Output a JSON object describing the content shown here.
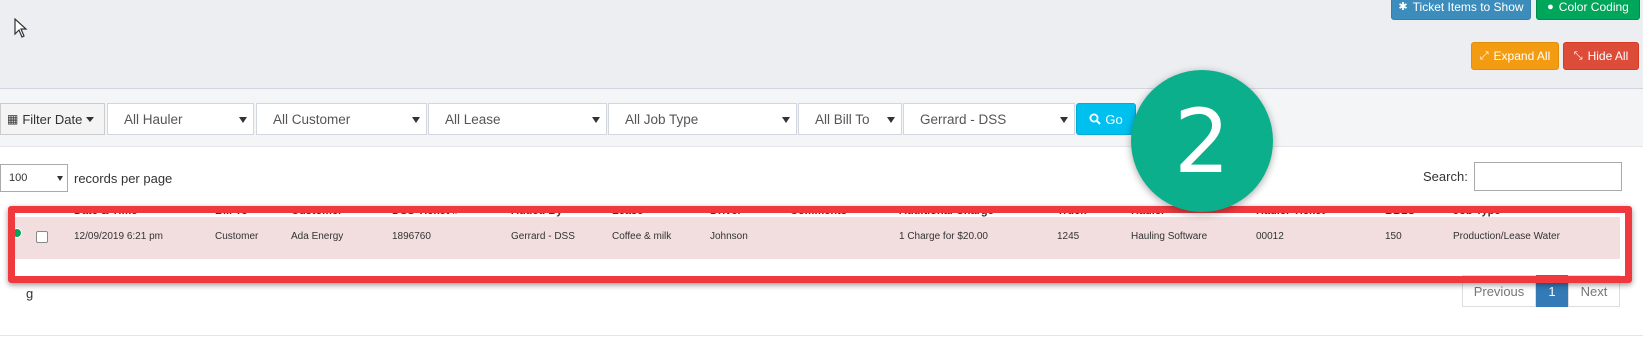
{
  "toolbar": {
    "ticket_items_label": "Ticket Items to Show",
    "color_coding_label": "Color Coding",
    "expand_all_label": "Expand All",
    "hide_all_label": "Hide All"
  },
  "filters": {
    "filter_date_label": "Filter Date",
    "hauler": "All Hauler",
    "customer": "All Customer",
    "lease": "All Lease",
    "job_type": "All Job Type",
    "bill_to": "All Bill To",
    "added_by": "Gerrard - DSS",
    "go_label": "Go"
  },
  "step_badge": "2",
  "table_controls": {
    "records_value": "100",
    "records_label": "records per page",
    "search_label": "Search:",
    "search_value": ""
  },
  "table": {
    "columns": [
      "Date & Time",
      "Bill To",
      "Customer",
      "DSS Ticket #",
      "Added By",
      "Lease",
      "Driver",
      "Comments",
      "Additional Charge",
      "Truck",
      "Hauler",
      "Hauler Ticket",
      "BBLS",
      "Job Type"
    ],
    "row": {
      "date_time": "12/09/2019 6:21 pm",
      "bill_to": "Customer",
      "customer": "Ada Energy",
      "dss_ticket": "1896760",
      "added_by": "Gerrard - DSS",
      "lease": "Coffee & milk",
      "driver": "Johnson",
      "comments": "",
      "additional_charge": "1 Charge for $20.00",
      "truck": "1245",
      "hauler": "Hauling Software",
      "hauler_ticket": "00012",
      "bbls": "150",
      "job_type": "Production/Lease Water"
    }
  },
  "pagination": {
    "showing_fragment": "g",
    "prev_label": "Previous",
    "current_page": "1",
    "next_label": "Next"
  },
  "colors": {
    "highlight_border": "#f0393f",
    "badge_bg": "#0caf8c",
    "row_bg": "#f2dede"
  }
}
